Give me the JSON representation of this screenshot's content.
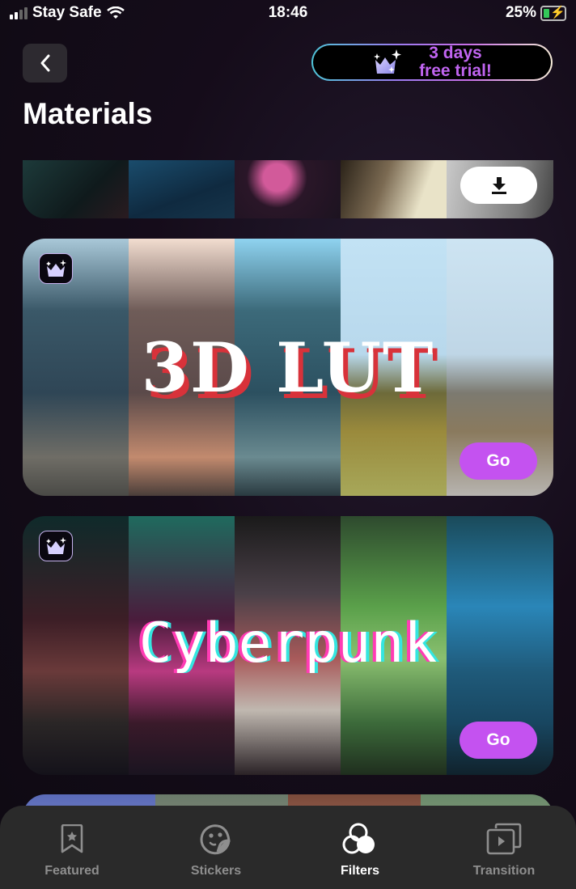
{
  "status_bar": {
    "carrier": "Stay Safe",
    "time": "18:46",
    "battery": "25%",
    "battery_level": 0.25,
    "charging": true
  },
  "header": {
    "back_icon": "chevron-left-icon",
    "trial_button": {
      "line1": "3 days",
      "line2": "free trial!",
      "icon": "crown-sparkle-icon"
    },
    "title": "Materials"
  },
  "colors": {
    "accent": "#c452f0",
    "trial_text": "#c064f0",
    "tab_bar": "#2a2a2a",
    "tab_inactive": "#8e8e8e",
    "tab_active": "#ffffff"
  },
  "cards": [
    {
      "name": "top-filter-pack",
      "action": "download",
      "action_icon": "download-icon",
      "premium": false
    },
    {
      "name": "3d-lut",
      "title": "3D LUT",
      "action": "Go",
      "premium": true
    },
    {
      "name": "cyberpunk",
      "title": "Cyberpunk",
      "action": "Go",
      "premium": true
    },
    {
      "name": "bottom-filter-pack",
      "premium": false
    }
  ],
  "tabs": [
    {
      "label": "Featured",
      "icon": "bookmark-star-icon",
      "active": false
    },
    {
      "label": "Stickers",
      "icon": "sticker-icon",
      "active": false
    },
    {
      "label": "Filters",
      "icon": "filters-icon",
      "active": true
    },
    {
      "label": "Transition",
      "icon": "transition-icon",
      "active": false
    }
  ]
}
